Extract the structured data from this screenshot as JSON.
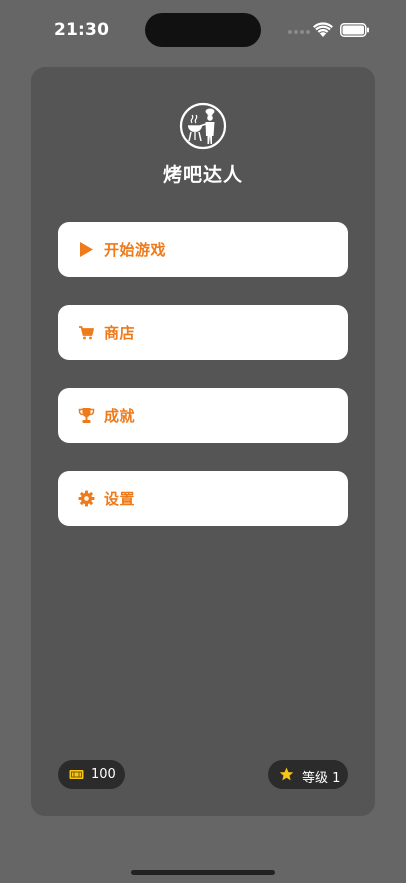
{
  "status_bar": {
    "time": "21:30"
  },
  "app": {
    "title": "烤吧达人",
    "logo_icon": "bbq-chef-icon"
  },
  "menu": [
    {
      "label": "开始游戏",
      "icon": "play-icon"
    },
    {
      "label": "商店",
      "icon": "cart-icon"
    },
    {
      "label": "成就",
      "icon": "trophy-icon"
    },
    {
      "label": "设置",
      "icon": "gear-icon"
    }
  ],
  "footer": {
    "coins": "100",
    "coins_icon": "ticket-icon",
    "level": "等级 1",
    "level_icon": "star-icon"
  },
  "colors": {
    "background": "#666666",
    "card": "#555555",
    "accent": "#ee7a1a",
    "button": "#ffffff",
    "pill": "#2b2b2b",
    "star": "#f5c518"
  }
}
